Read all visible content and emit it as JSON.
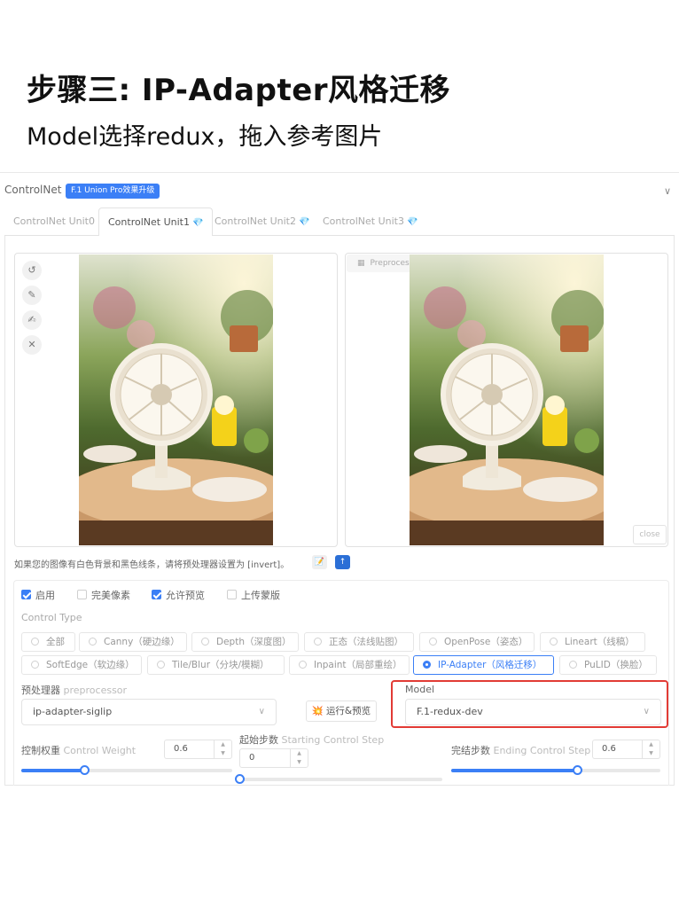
{
  "page": {
    "title": "步骤三: IP-Adapter风格迁移",
    "subtitle": "Model选择redux，拖入参考图片"
  },
  "controlnet": {
    "title": "ControlNet",
    "badge": "F.1 Union Pro效果升级",
    "tabs": [
      {
        "label": "ControlNet Unit0",
        "active": false,
        "gem": false
      },
      {
        "label": "ControlNet Unit1",
        "active": true,
        "gem": true
      },
      {
        "label": "ControlNet Unit2",
        "active": false,
        "gem": true
      },
      {
        "label": "ControlNet Unit3",
        "active": false,
        "gem": true
      }
    ],
    "gem_icon": "💎",
    "preview_label": "Preprocessor Preview",
    "close_label": "close",
    "hint": "如果您的图像有白色背景和黑色线条，请将预处理器设置为 [invert]。",
    "checkboxes": [
      {
        "label": "启用",
        "checked": true
      },
      {
        "label": "完美像素",
        "checked": false
      },
      {
        "label": "允许预览",
        "checked": true
      },
      {
        "label": "上传蒙版",
        "checked": false
      }
    ],
    "control_type_label": "Control Type",
    "control_types": [
      {
        "label": "全部",
        "selected": false
      },
      {
        "label": "Canny（硬边缘）",
        "selected": false
      },
      {
        "label": "Depth（深度图）",
        "selected": false
      },
      {
        "label": "正态（法线贴图）",
        "selected": false
      },
      {
        "label": "OpenPose（姿态）",
        "selected": false
      },
      {
        "label": "Lineart（线稿）",
        "selected": false
      },
      {
        "label": "SoftEdge（软边缘）",
        "selected": false
      },
      {
        "label": "Tile/Blur（分块/模糊）",
        "selected": false
      },
      {
        "label": "Inpaint（局部重绘）",
        "selected": false
      },
      {
        "label": "IP-Adapter（风格迁移）",
        "selected": true
      },
      {
        "label": "PuLID（换脸）",
        "selected": false
      }
    ],
    "preprocessor": {
      "label_cn": "预处理器",
      "label_en": "preprocessor",
      "value": "ip-adapter-siglip"
    },
    "run_button": {
      "icon": "💥",
      "label": "运行&预览"
    },
    "model": {
      "label": "Model",
      "value": "F.1-redux-dev"
    },
    "control_weight": {
      "label_cn": "控制权重",
      "label_en": "Control Weight",
      "value": "0.6",
      "fraction": 0.3
    },
    "starting_step": {
      "label_cn": "起始步数",
      "label_en": "Starting Control Step",
      "value": "0",
      "fraction": 0.0
    },
    "ending_step": {
      "label_cn": "完结步数",
      "label_en": "Ending Control Step",
      "value": "0.6",
      "fraction": 0.6
    },
    "colors": {
      "accent": "#3b7ff6",
      "highlight": "#e23b35"
    }
  }
}
